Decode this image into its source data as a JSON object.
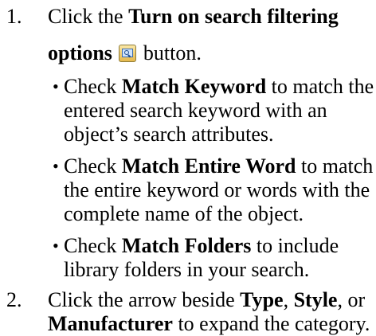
{
  "steps": [
    {
      "number": "1.",
      "line1_pre": "Click the ",
      "line1_bold": "Turn on search filtering",
      "line2_bold": "options",
      "line2_post": " button.",
      "icon": "search-filter-icon",
      "bullets": [
        {
          "marker": "•",
          "pre": "Check ",
          "bold": "Match Keyword",
          "post": " to match the",
          "lines": [
            "entered search keyword with an",
            "object’s search attributes."
          ]
        },
        {
          "marker": "•",
          "pre": "Check ",
          "bold": "Match Entire Word",
          "post": " to match",
          "lines": [
            "the entire keyword or words with the",
            "complete name of the object."
          ]
        },
        {
          "marker": "•",
          "pre": "Check ",
          "bold": "Match Folders",
          "post": " to include",
          "lines": [
            "library folders in your search."
          ]
        }
      ]
    },
    {
      "number": "2.",
      "line1_pre": "Click the arrow beside ",
      "bold_type": "Type",
      "sep1": ", ",
      "bold_style": "Style",
      "sep2": ", or",
      "bold_manufacturer": "Manufacturer",
      "line2_post": " to expand the category."
    }
  ]
}
